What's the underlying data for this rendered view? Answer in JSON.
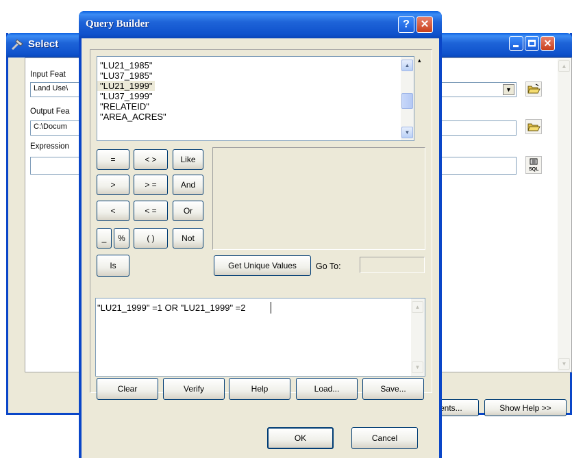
{
  "select_window": {
    "title": "Select",
    "input_features_label": "Input Feat",
    "input_features_value": "Land Use\\",
    "output_feature_label": "Output Fea",
    "output_feature_value": "C:\\Docum",
    "expression_label": "Expression",
    "expression_value": "",
    "environments_label": "ents...",
    "show_help_label": "Show Help >>"
  },
  "query_builder": {
    "title": "Query Builder",
    "help_label": "?",
    "close_label": "✕",
    "fields": [
      "\"LU21_1985\"",
      "\"LU37_1985\"",
      "\"LU21_1999\"",
      "\"LU37_1999\"",
      "\"RELATEID\"",
      "\"AREA_ACRES\""
    ],
    "operators": {
      "eq": "=",
      "ne": "< >",
      "like": "Like",
      "gt": ">",
      "ge": "> =",
      "and": "And",
      "lt": "<",
      "le": "< =",
      "or": "Or",
      "underscore": "_",
      "percent": "%",
      "parens": "( )",
      "not": "Not",
      "is": "Is"
    },
    "get_unique_values_label": "Get Unique Values",
    "go_to_label": "Go To:",
    "go_to_value": "",
    "expression": "\"LU21_1999\" =1 OR \"LU21_1999\" =2",
    "clear_label": "Clear",
    "verify_label": "Verify",
    "help_button_label": "Help",
    "load_label": "Load...",
    "save_label": "Save...",
    "ok_label": "OK",
    "cancel_label": "Cancel"
  },
  "colors": {
    "titlebar": "#0a5fe0",
    "dialog_bg": "#ece9d8",
    "close_red": "#c8401c"
  }
}
